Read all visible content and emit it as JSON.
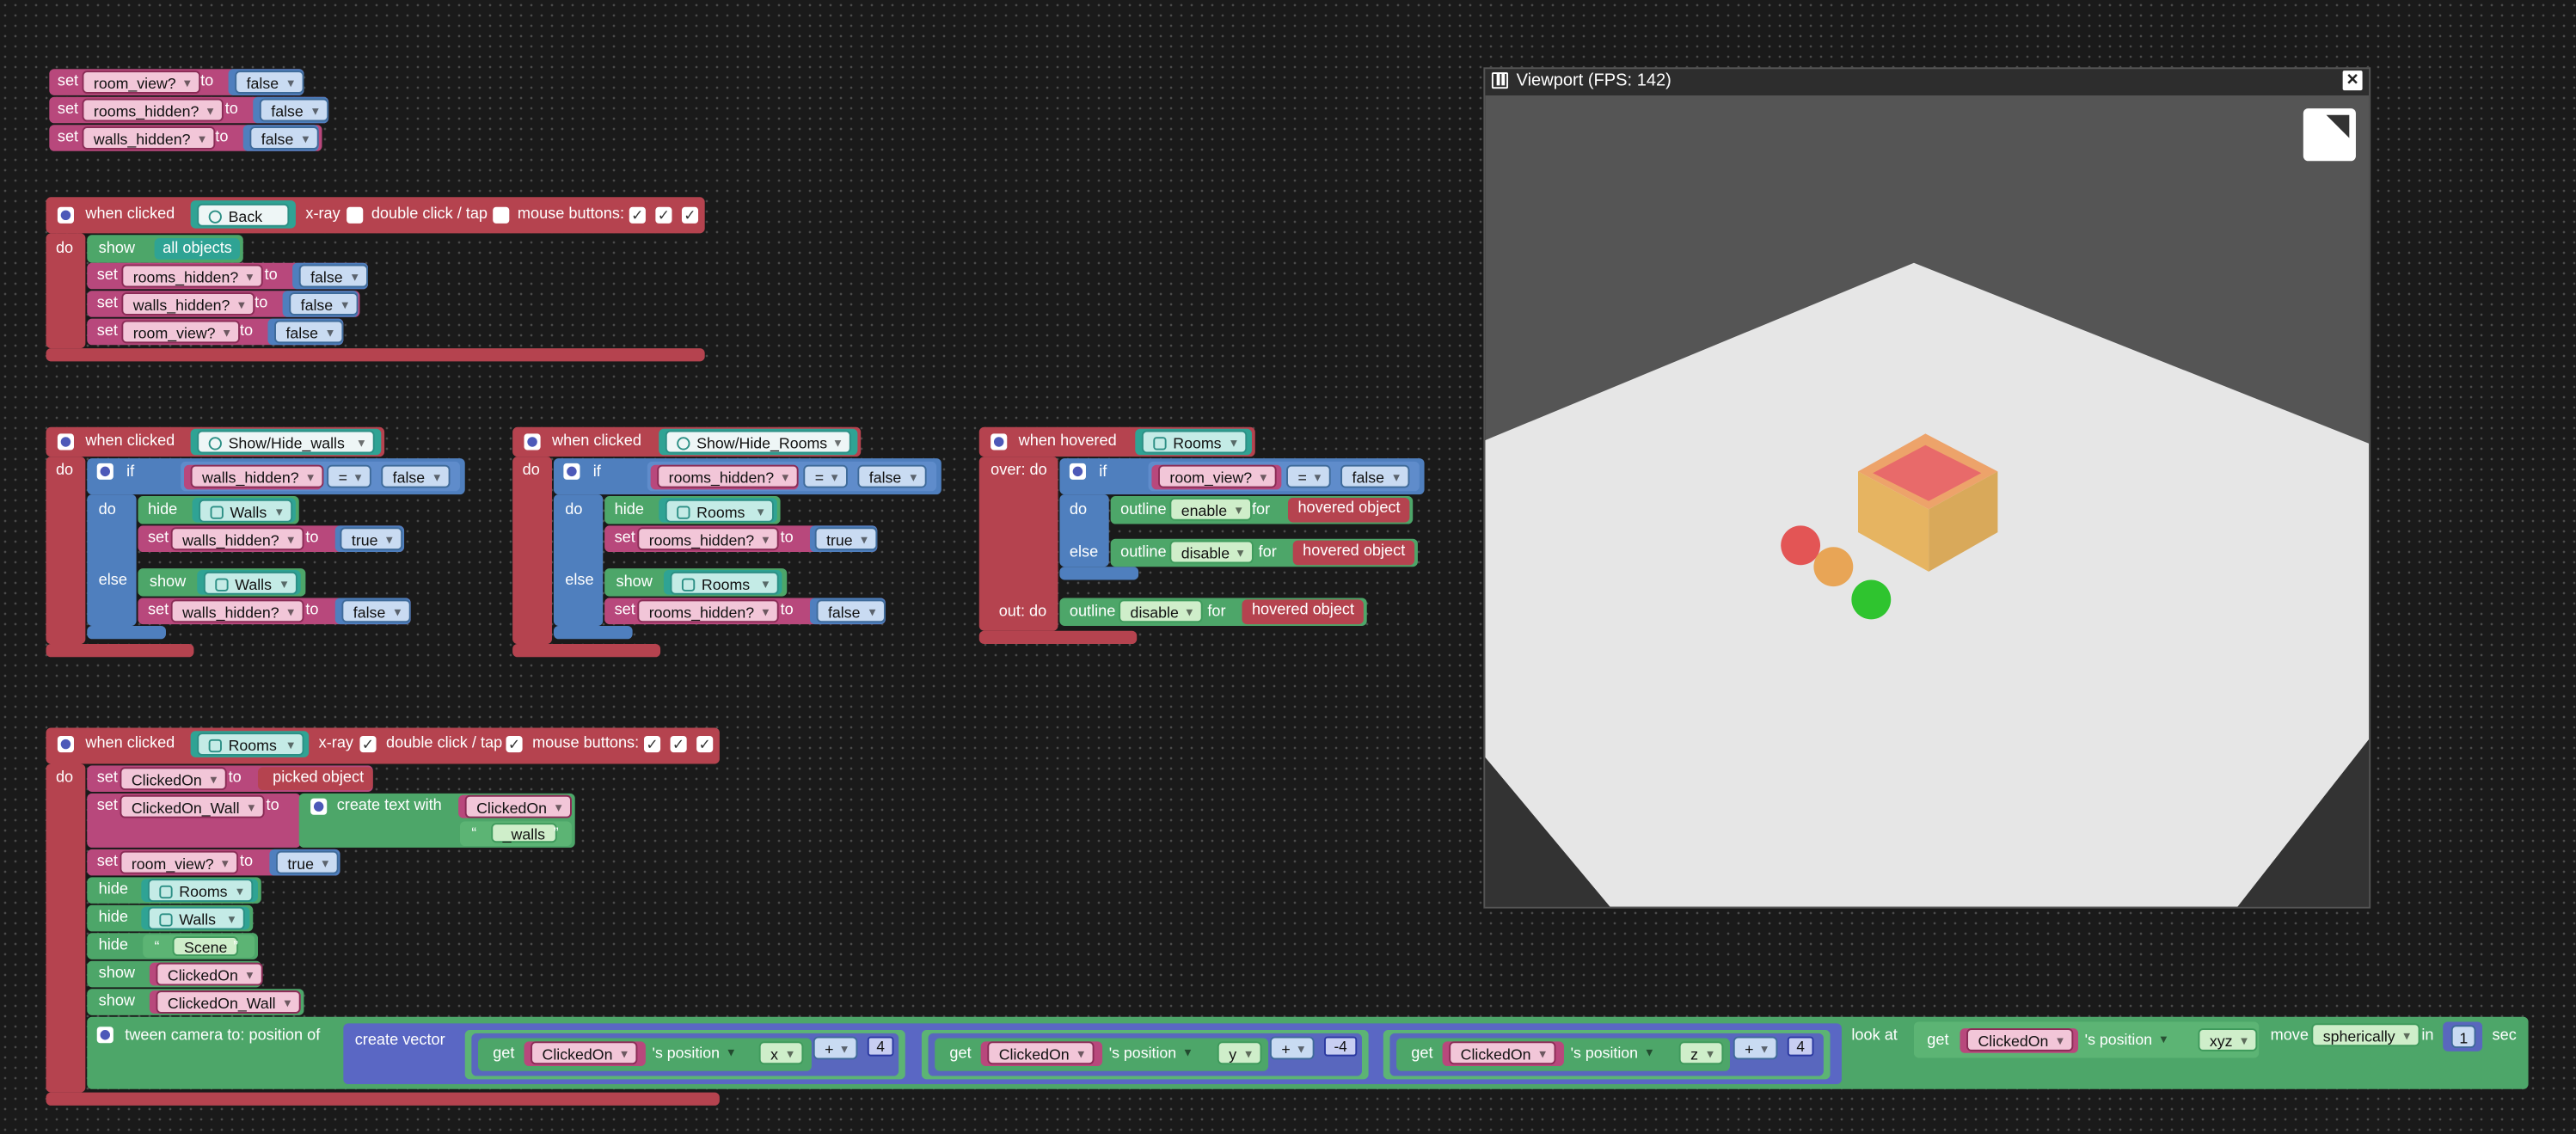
{
  "vars": {
    "room_view": "room_view?",
    "rooms_hidden": "rooms_hidden?",
    "walls_hidden": "walls_hidden?"
  },
  "kw": {
    "set": "set",
    "to": "to",
    "do": "do",
    "if": "if",
    "else": "else",
    "show": "show",
    "hide": "hide",
    "false": "false",
    "true": "true",
    "eq": "=",
    "when_clicked": "when clicked",
    "when_hovered": "when hovered",
    "xray": "x-ray",
    "dblclick": "double click / tap",
    "mouse_buttons": "mouse buttons:",
    "all_objects": "all objects",
    "outline": "outline",
    "enable": "enable",
    "disable": "disable",
    "for": "for",
    "hovered_object": "hovered object",
    "over_do": "over: do",
    "out_do": "out: do",
    "picked_object": "picked object",
    "create_text_with": "create text with",
    "get": "get",
    "s_position": "'s position",
    "tween": "tween camera to:  position of",
    "create_vector": "create vector",
    "plus": "+",
    "look_at": "look at",
    "xyz": "xyz",
    "move": "move",
    "spherically": "spherically",
    "in": "in",
    "sec": "sec",
    "open_quote": "“",
    "close_quote": "”",
    "check": "✓"
  },
  "objects": {
    "back": "Back",
    "show_hide_walls": "Show/Hide_walls",
    "show_hide_rooms": "Show/Hide_Rooms",
    "rooms": "Rooms",
    "walls": "Walls",
    "scene": "Scene",
    "clickedon": "ClickedOn",
    "clickedon_wall": "ClickedOn_Wall",
    "walls_suffix": "_walls"
  },
  "vector": {
    "x": {
      "axis": "x",
      "op": "+",
      "val": "4"
    },
    "y": {
      "axis": "y",
      "op": "+",
      "val": "-4"
    },
    "z": {
      "axis": "z",
      "op": "+",
      "val": "4"
    }
  },
  "tween_duration": "1",
  "viewport": {
    "title": "Viewport (FPS: 142)",
    "close": "×"
  },
  "colors": {
    "event": "#b5434f",
    "variable": "#b8487c",
    "logic": "#4f7fbe",
    "visibility": "#4da669",
    "object": "#2fa394",
    "list": "#5a67c4"
  }
}
